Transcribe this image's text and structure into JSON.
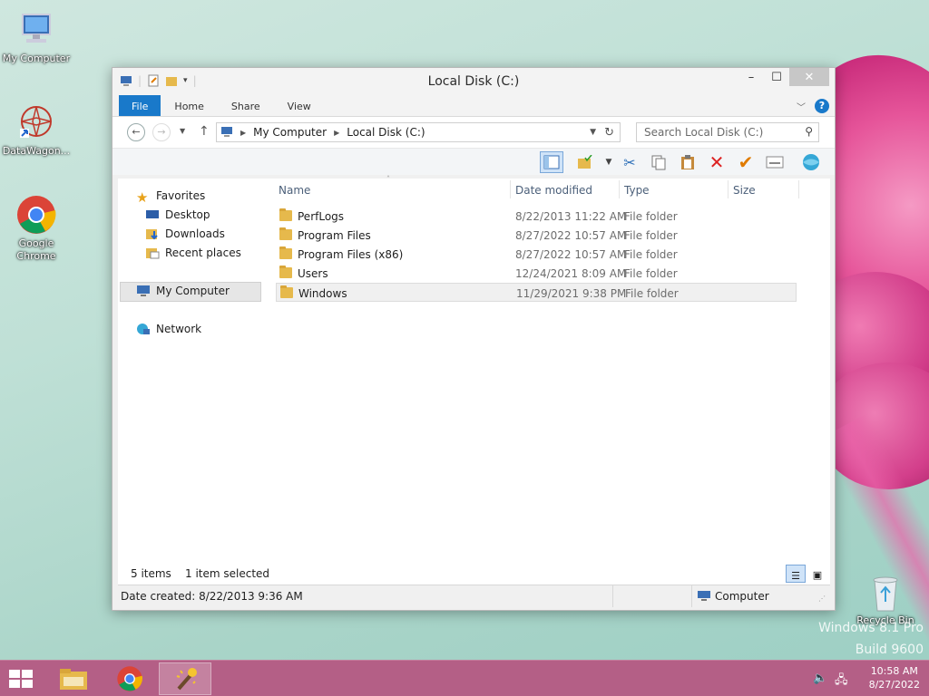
{
  "desktop": {
    "icons": [
      {
        "label": "My Computer"
      },
      {
        "label": "DataWagon..."
      },
      {
        "label": "Google Chrome"
      },
      {
        "label": "Recycle Bin"
      }
    ],
    "watermark_line1": "Windows 8.1 Pro",
    "watermark_line2": "Build 9600"
  },
  "window": {
    "title": "Local Disk (C:)",
    "ribbon_tabs": [
      "File",
      "Home",
      "Share",
      "View"
    ],
    "nav": {
      "back": "←",
      "forward": "→",
      "up": "↑",
      "breadcrumb": [
        "My Computer",
        "Local Disk (C:)"
      ],
      "search_placeholder": "Search Local Disk (C:)"
    },
    "sidebar": {
      "favorites": "Favorites",
      "desktop": "Desktop",
      "downloads": "Downloads",
      "recent": "Recent places",
      "computer": "My Computer",
      "network": "Network"
    },
    "columns": [
      "Name",
      "Date modified",
      "Type",
      "Size"
    ],
    "rows": [
      {
        "name": "PerfLogs",
        "date": "8/22/2013 11:22 AM",
        "type": "File folder"
      },
      {
        "name": "Program Files",
        "date": "8/27/2022 10:57 AM",
        "type": "File folder"
      },
      {
        "name": "Program Files (x86)",
        "date": "8/27/2022 10:57 AM",
        "type": "File folder"
      },
      {
        "name": "Users",
        "date": "12/24/2021 8:09 AM",
        "type": "File folder"
      },
      {
        "name": "Windows",
        "date": "11/29/2021 9:38 PM",
        "type": "File folder"
      }
    ],
    "status": {
      "items": "5 items",
      "selected": "1 item selected"
    },
    "details": {
      "date_created": "Date created: 8/22/2013 9:36 AM",
      "location": "Computer"
    }
  },
  "taskbar": {
    "time": "10:58 AM",
    "date": "8/27/2022"
  },
  "colors": {
    "accent": "#1979ca",
    "taskbar": "#b45f86"
  }
}
